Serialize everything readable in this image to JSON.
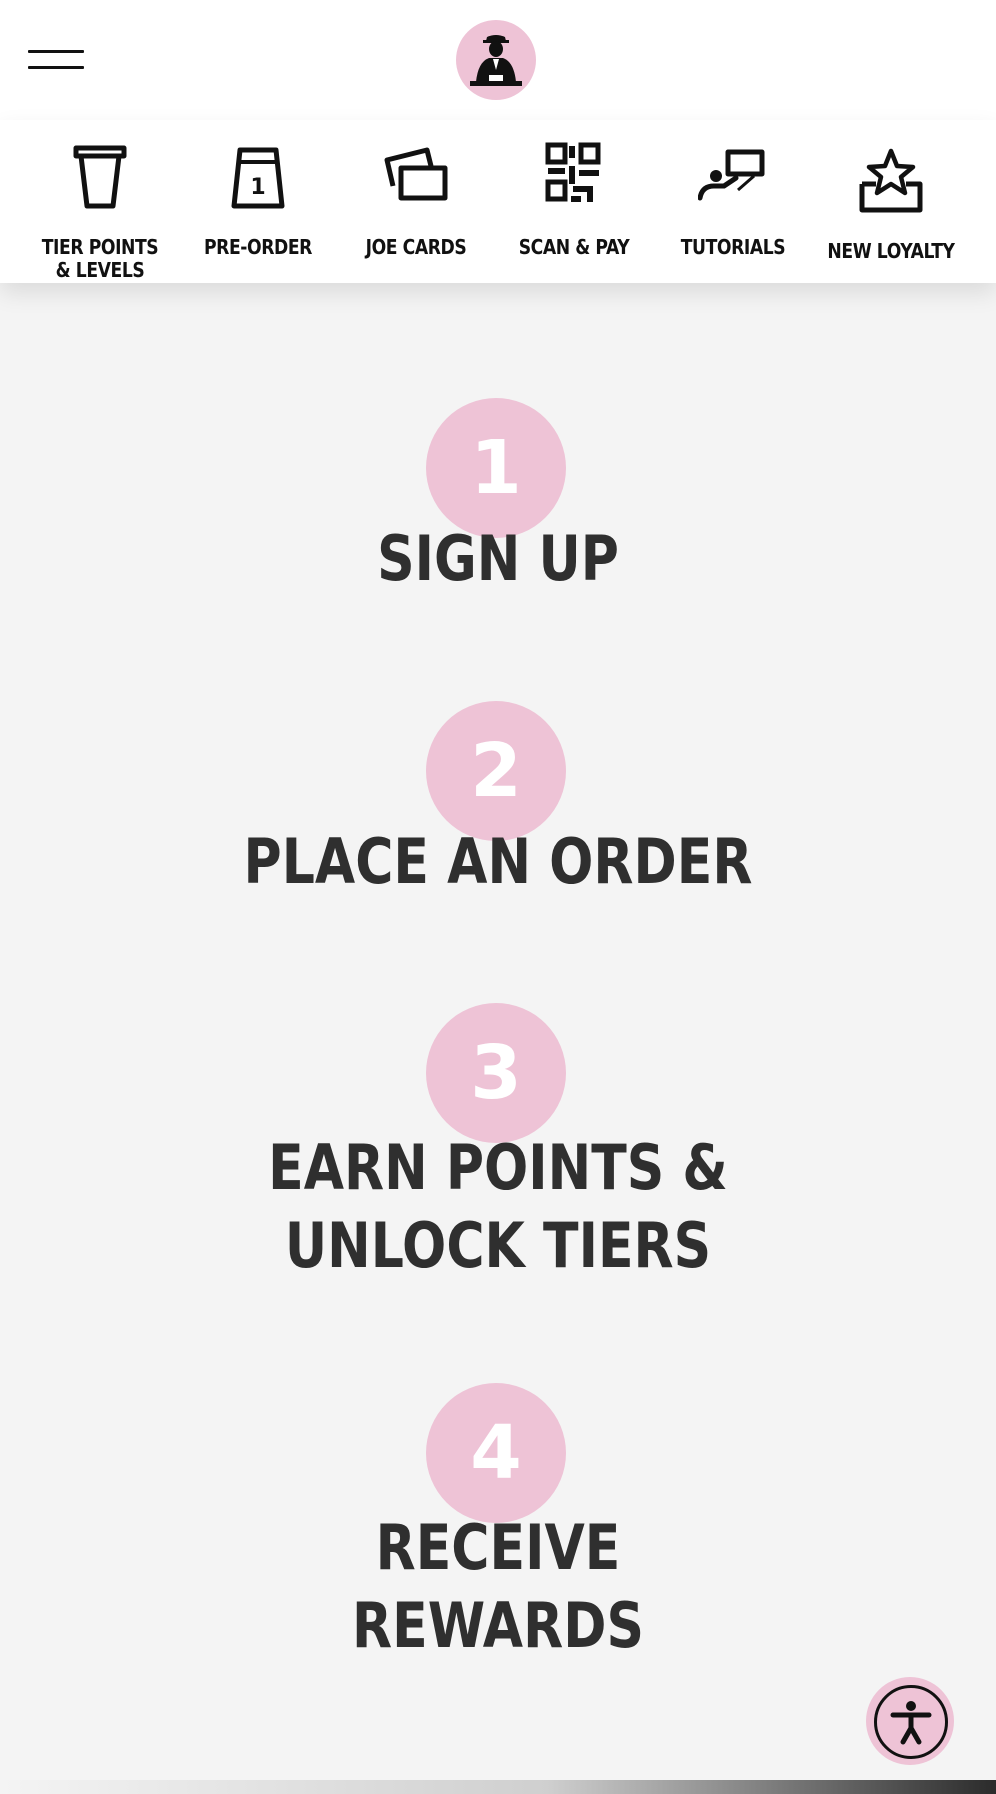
{
  "header": {
    "menu_icon": "hamburger-menu-icon",
    "logo_icon": "joe-logo-icon"
  },
  "quick_nav": [
    {
      "label": "TIER POINTS\n& LEVELS",
      "icon": "cup-icon"
    },
    {
      "label": "PRE-ORDER",
      "icon": "pre-order-bag-icon",
      "icon_text": "1"
    },
    {
      "label": "JOE CARDS",
      "icon": "cards-icon"
    },
    {
      "label": "SCAN & PAY",
      "icon": "qr-code-icon"
    },
    {
      "label": "TUTORIALS",
      "icon": "tutorial-presenter-icon"
    },
    {
      "label": "NEW LOYALTY",
      "icon": "star-box-icon"
    }
  ],
  "steps": [
    {
      "number": "1",
      "title": "SIGN UP"
    },
    {
      "number": "2",
      "title": "PLACE AN ORDER"
    },
    {
      "number": "3",
      "title": "EARN POINTS &\nUNLOCK TIERS"
    },
    {
      "number": "4",
      "title": "RECEIVE\nREWARDS"
    }
  ],
  "accessibility": {
    "icon": "accessibility-person-icon"
  },
  "colors": {
    "accent_pink": "#eec3d6",
    "text_dark": "#2f2f2f",
    "background": "#f4f4f4",
    "header_bg": "#ffffff"
  }
}
